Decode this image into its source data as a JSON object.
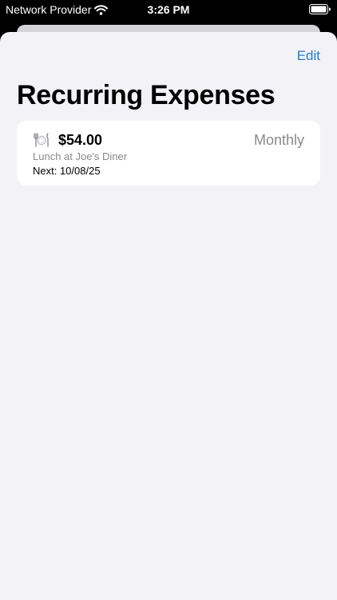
{
  "status_bar": {
    "carrier": "Network Provider",
    "time": "3:26 PM",
    "icons": [
      "wifi-icon",
      "battery-icon"
    ]
  },
  "nav": {
    "edit_label": "Edit"
  },
  "page": {
    "title": "Recurring Expenses"
  },
  "expenses": [
    {
      "icon": "plate-with-cutlery-icon",
      "amount": "$54.00",
      "frequency": "Monthly",
      "description": "Lunch at Joe's Diner",
      "next": "Next: 10/08/25"
    }
  ],
  "colors": {
    "accent": "#1a7fd0",
    "background": "#f2f2f7",
    "card": "#ffffff",
    "secondary_text": "#8a8a8e"
  }
}
